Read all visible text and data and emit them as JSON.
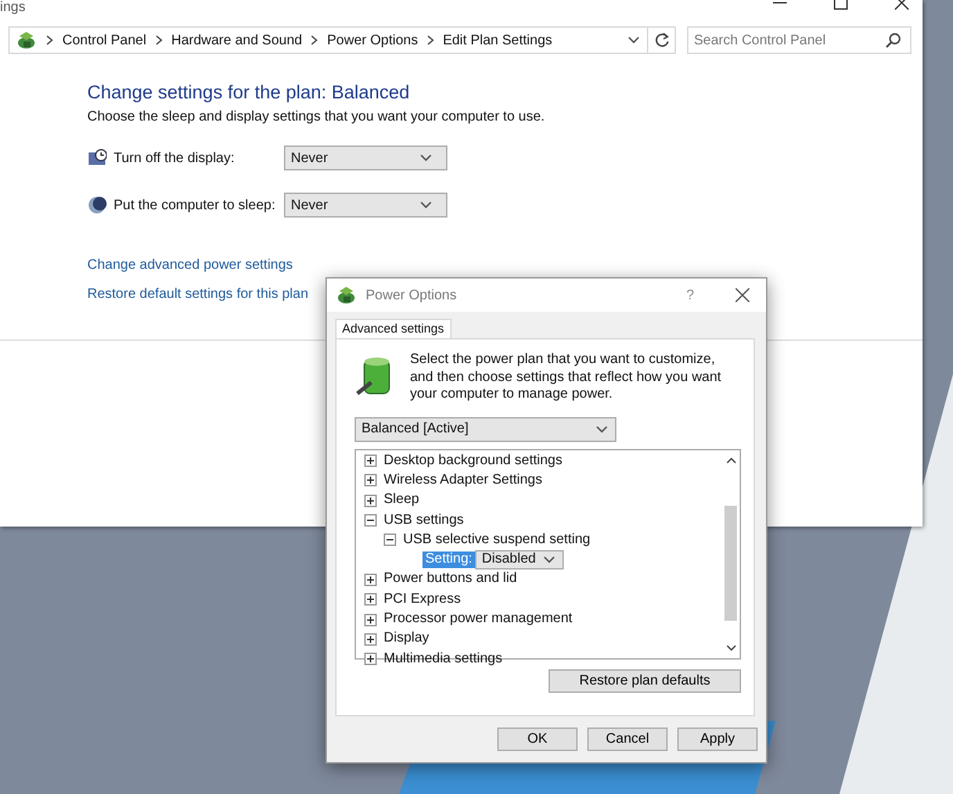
{
  "main_window": {
    "title": "ings",
    "address_bar": {
      "crumbs": [
        "Control Panel",
        "Hardware and Sound",
        "Power Options",
        "Edit Plan Settings"
      ]
    },
    "search": {
      "placeholder": "Search Control Panel"
    },
    "heading": "Change settings for the plan: Balanced",
    "subheading": "Choose the sleep and display settings that you want your computer to use.",
    "settings": [
      {
        "kind": "display",
        "label": "Turn off the display:",
        "value": "Never"
      },
      {
        "kind": "sleep",
        "label": "Put the computer to sleep:",
        "value": "Never"
      }
    ],
    "links": [
      "Change advanced power settings",
      "Restore default settings for this plan"
    ]
  },
  "dialog": {
    "title": "Power Options",
    "help": "?",
    "tabs": [
      {
        "label": "Advanced settings",
        "selected": true
      }
    ],
    "description": "Select the power plan that you want to customize, and then choose settings that reflect how you want your computer to manage power.",
    "plan": "Balanced [Active]",
    "tree": [
      {
        "kind": "group",
        "label": "Desktop background settings",
        "expanded": false
      },
      {
        "kind": "group",
        "label": "Wireless Adapter Settings",
        "expanded": false
      },
      {
        "kind": "group",
        "label": "Sleep",
        "expanded": false
      },
      {
        "kind": "group",
        "label": "USB settings",
        "expanded": true,
        "children": [
          {
            "kind": "group",
            "label": "USB selective suspend setting",
            "expanded": true,
            "children": [
              {
                "kind": "setting",
                "label": "Setting:",
                "value": "Disabled"
              }
            ]
          }
        ]
      },
      {
        "kind": "group",
        "label": "Power buttons and lid",
        "expanded": false
      },
      {
        "kind": "group",
        "label": "PCI Express",
        "expanded": false
      },
      {
        "kind": "group",
        "label": "Processor power management",
        "expanded": false
      },
      {
        "kind": "group",
        "label": "Display",
        "expanded": false
      },
      {
        "kind": "group",
        "label": "Multimedia settings",
        "expanded": false
      }
    ],
    "restore_button": "Restore plan defaults",
    "buttons": [
      "OK",
      "Cancel",
      "Apply"
    ]
  }
}
